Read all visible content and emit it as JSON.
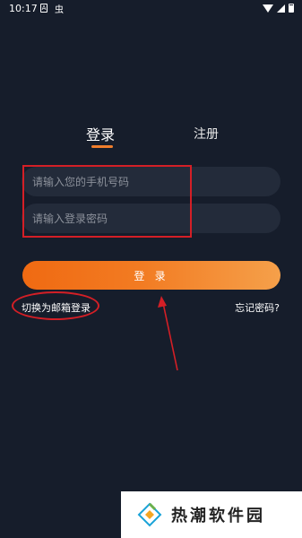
{
  "status_bar": {
    "time": "10:17",
    "icon_a": "A",
    "icon_b": "虫"
  },
  "tabs": {
    "login": "登录",
    "register": "注册"
  },
  "form": {
    "phone_placeholder": "请输入您的手机号码",
    "password_placeholder": "请输入登录密码",
    "login_button": "登 录"
  },
  "links": {
    "switch_email": "切换为邮箱登录",
    "forgot_password": "忘记密码?"
  },
  "watermark": {
    "text": "热潮软件园"
  },
  "colors": {
    "background": "#161d2b",
    "accent": "#f07e2c",
    "annotation_red": "#d41f26"
  }
}
